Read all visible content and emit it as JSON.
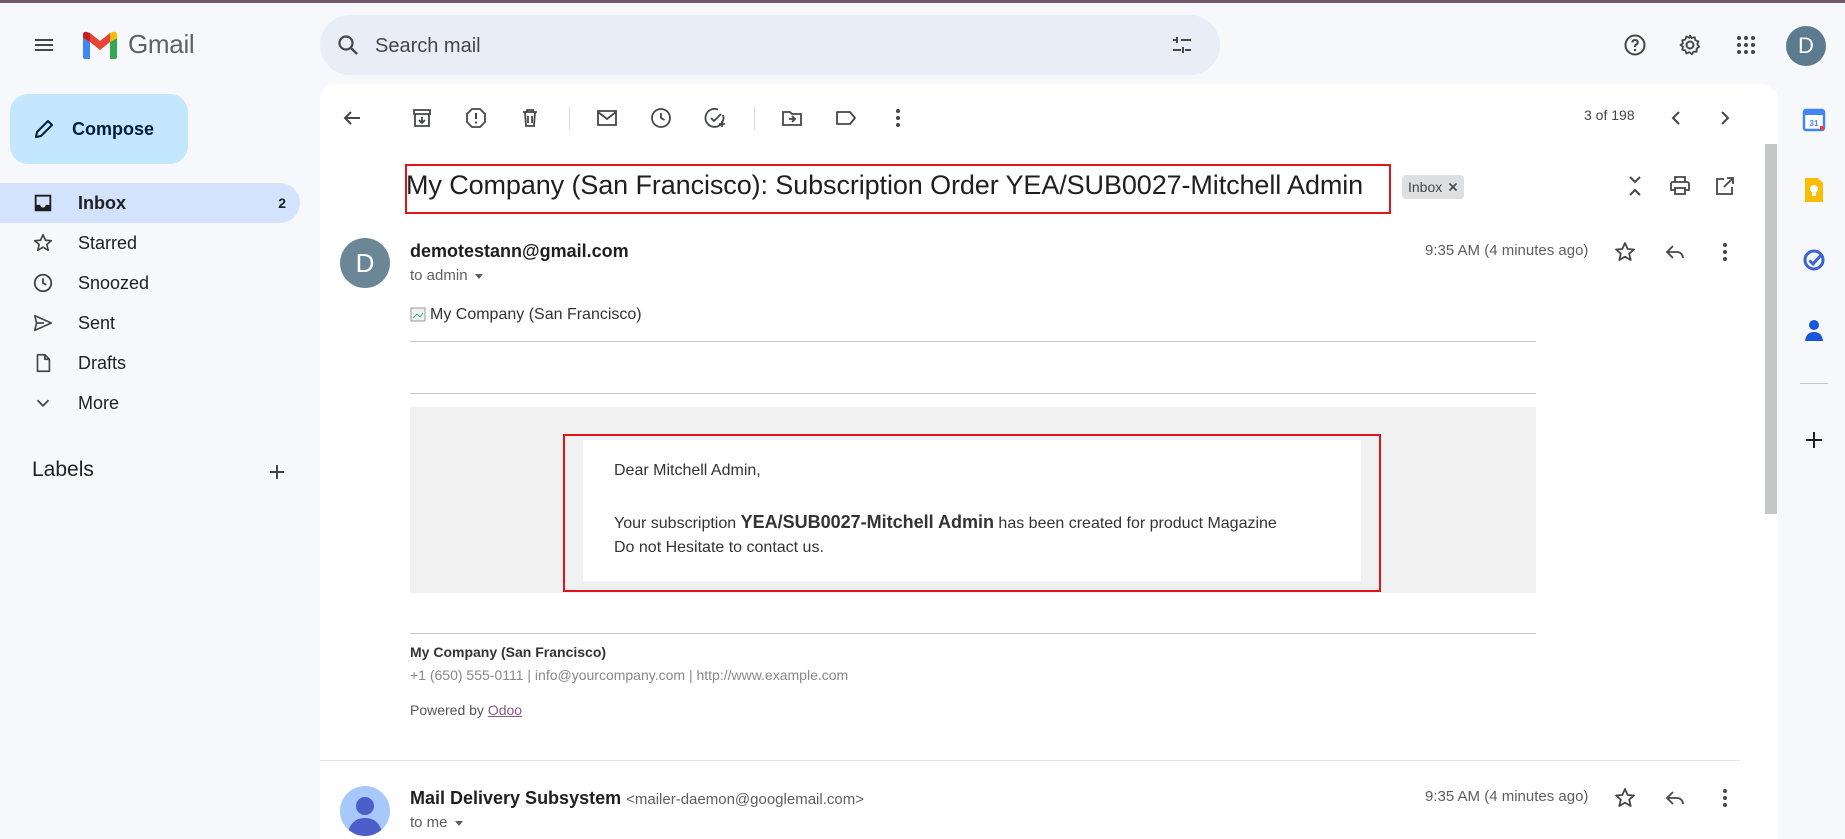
{
  "app": {
    "name": "Gmail"
  },
  "search": {
    "placeholder": "Search mail"
  },
  "compose": {
    "label": "Compose"
  },
  "nav": [
    {
      "label": "Inbox",
      "count": "2",
      "active": true
    },
    {
      "label": "Starred",
      "count": ""
    },
    {
      "label": "Snoozed",
      "count": ""
    },
    {
      "label": "Sent",
      "count": ""
    },
    {
      "label": "Drafts",
      "count": ""
    },
    {
      "label": "More",
      "count": ""
    }
  ],
  "labels": {
    "heading": "Labels"
  },
  "user": {
    "initial": "D"
  },
  "toolbar": {
    "pager": "3 of 198"
  },
  "thread": {
    "subject": "My Company (San Francisco): Subscription Order YEA/SUB0027-Mitchell Admin",
    "chip": "Inbox"
  },
  "message1": {
    "avatar_initial": "D",
    "sender": "demotestann@gmail.com",
    "to": "to admin",
    "time": "9:35 AM (4 minutes ago)",
    "logo_alt": "My Company (San Francisco)",
    "greeting": "Dear Mitchell Admin,",
    "body_pre": "Your subscription ",
    "body_bold": "YEA/SUB0027-Mitchell Admin",
    "body_post": " has been created for product Magazine",
    "body_line2": "Do not Hesitate to contact us.",
    "company": "My Company (San Francisco)",
    "contact": "+1 (650) 555-0111 | info@yourcompany.com | http://www.example.com",
    "powered_pre": "Powered by ",
    "powered_link": "Odoo"
  },
  "message2": {
    "sender": "Mail Delivery Subsystem",
    "address": "<mailer-daemon@googlemail.com>",
    "to": "to me",
    "time": "9:35 AM (4 minutes ago)"
  },
  "colors": {
    "accent": "#c2e7ff",
    "active_nav": "#d3e3fd",
    "highlight_box": "#e0141b",
    "link": "#875a7b"
  }
}
